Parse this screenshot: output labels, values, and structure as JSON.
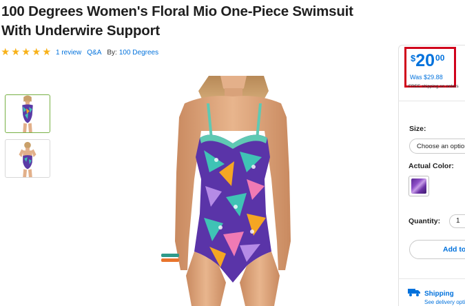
{
  "product": {
    "title_line1": "100 Degrees Women's Floral Mio One-Piece Swimsuit",
    "title_line2": "With Underwire Support",
    "rating_stars": 5,
    "reviews_link": "1 review",
    "qa_link": "Q&A",
    "by_label": "By:",
    "brand": "100 Degrees"
  },
  "gallery": {
    "thumbnails": [
      {
        "name": "front view",
        "selected": true
      },
      {
        "name": "back view",
        "selected": false
      }
    ]
  },
  "pricing": {
    "currency": "$",
    "whole": "20",
    "cents": "00",
    "was_price": "Was $29.88",
    "shipping_note": "FREE shipping on orders"
  },
  "options": {
    "size_label": "Size:",
    "size_placeholder": "Choose an option",
    "color_label": "Actual Color:",
    "quantity_label": "Quantity:",
    "quantity_value": "1",
    "add_button": "Add to Cart"
  },
  "shipping": {
    "title": "Shipping",
    "subtitle": "See delivery options"
  },
  "colors": {
    "accent": "#0071dc",
    "star": "#f8b21a",
    "highlight": "#d0021b",
    "selected_thumb": "#76b043"
  }
}
